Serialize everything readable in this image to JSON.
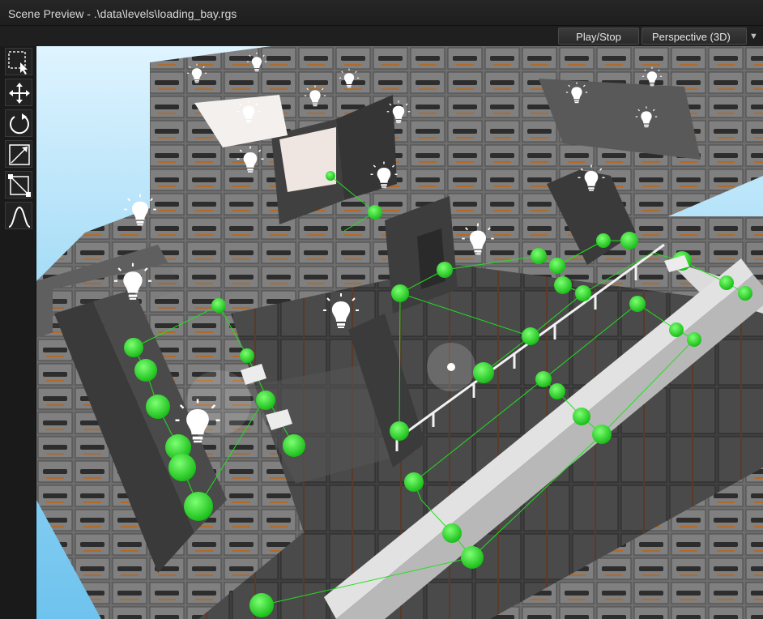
{
  "window": {
    "title": "Scene Preview - .\\data\\levels\\loading_bay.rgs"
  },
  "toolbar": {
    "play_stop_label": "Play/Stop",
    "view_mode_label": "Perspective (3D)",
    "view_mode_arrow": "▼"
  },
  "tools": [
    {
      "name": "select-tool",
      "icon": "marquee-select-icon"
    },
    {
      "name": "move-tool",
      "icon": "move-arrows-icon"
    },
    {
      "name": "rotate-tool",
      "icon": "rotate-icon"
    },
    {
      "name": "scale-tool",
      "icon": "scale-icon"
    },
    {
      "name": "bounds-tool",
      "icon": "bounding-box-icon"
    },
    {
      "name": "curve-tool",
      "icon": "curve-icon"
    }
  ],
  "colors": {
    "sky": "#8fd0f2",
    "waypoint": "#22e01e",
    "wall": "#6f6f6f",
    "floor": "#3c3c3c"
  },
  "scene": {
    "light_icon": "light-bulb-icon",
    "waypoint_icon": "waypoint-sphere",
    "camera_mode": "Perspective (3D)"
  }
}
